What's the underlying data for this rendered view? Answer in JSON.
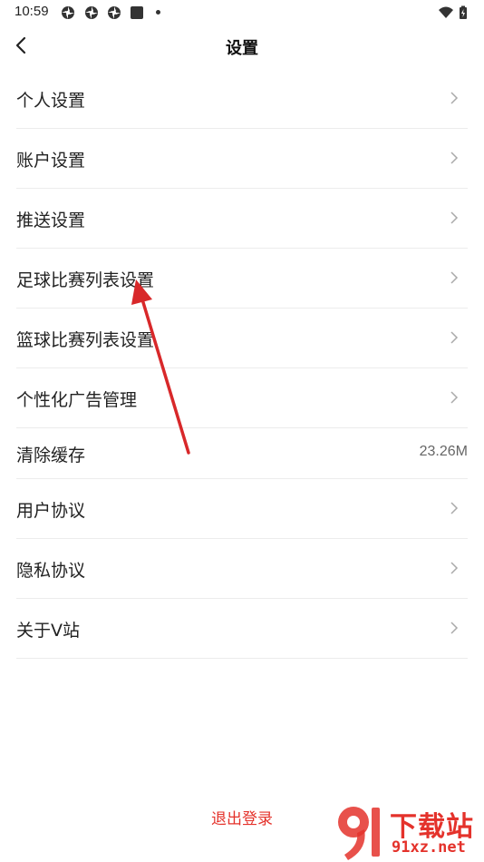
{
  "status_bar": {
    "time": "10:59"
  },
  "header": {
    "title": "设置"
  },
  "items": [
    {
      "label": "个人设置"
    },
    {
      "label": "账户设置"
    },
    {
      "label": "推送设置"
    },
    {
      "label": "足球比赛列表设置"
    },
    {
      "label": "篮球比赛列表设置"
    },
    {
      "label": "个性化广告管理"
    },
    {
      "label": "清除缓存",
      "value": "23.26M"
    },
    {
      "label": "用户协议"
    },
    {
      "label": "隐私协议"
    },
    {
      "label": "关于V站"
    }
  ],
  "logout_label": "退出登录",
  "watermark": {
    "title": "下载站",
    "url": "91xz.net"
  },
  "colors": {
    "accent": "#e4322b",
    "annotation_arrow": "#d8282a"
  }
}
